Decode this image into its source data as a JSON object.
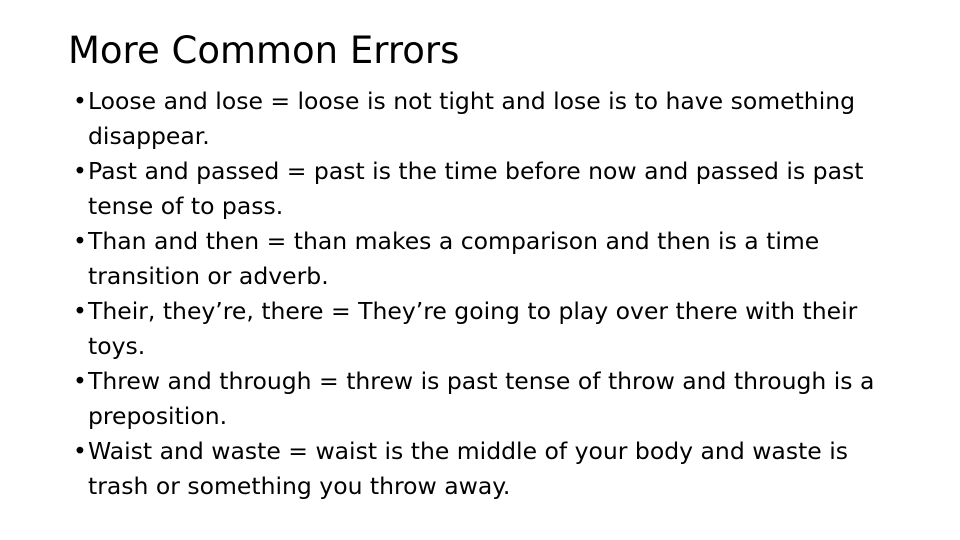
{
  "slide": {
    "title": "More Common Errors",
    "background_color": "#ffffff",
    "text_color": "#000000",
    "bullet_marker": "•",
    "bullets": [
      {
        "text": "Loose and lose = loose is not tight and lose is to have something disappear."
      },
      {
        "text": "Past and passed = past is the time before now and passed is past tense of to pass."
      },
      {
        "text": "Than and then = than makes a comparison and then is a time transition or adverb."
      },
      {
        "text": "Their, they’re, there = They’re going to play over there with their toys."
      },
      {
        "text": "Threw and through = threw is past tense of throw and through is a preposition."
      },
      {
        "text": "Waist and waste = waist is the middle of your body and waste is trash or something you throw away."
      }
    ]
  }
}
